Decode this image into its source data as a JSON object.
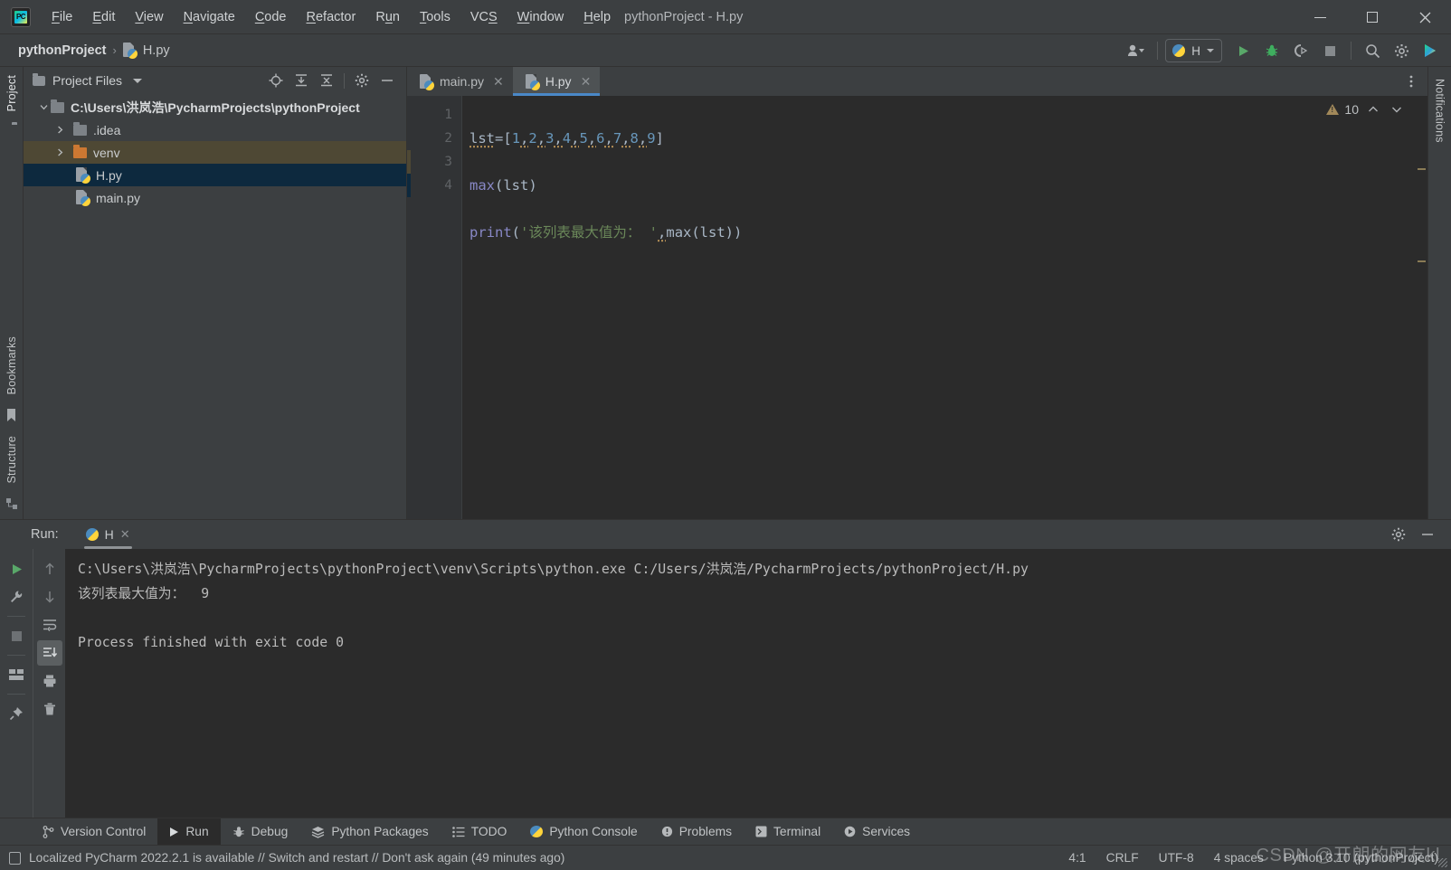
{
  "window": {
    "title": "pythonProject - H.py",
    "minimize": "–",
    "maximize": "☐",
    "close": "✕"
  },
  "menu": {
    "items": [
      {
        "label": "File",
        "mnemonic": "F"
      },
      {
        "label": "Edit",
        "mnemonic": "E"
      },
      {
        "label": "View",
        "mnemonic": "V"
      },
      {
        "label": "Navigate",
        "mnemonic": "N"
      },
      {
        "label": "Code",
        "mnemonic": "C"
      },
      {
        "label": "Refactor",
        "mnemonic": "R"
      },
      {
        "label": "Run",
        "mnemonic": "u"
      },
      {
        "label": "Tools",
        "mnemonic": "T"
      },
      {
        "label": "VCS",
        "mnemonic": "S"
      },
      {
        "label": "Window",
        "mnemonic": "W"
      },
      {
        "label": "Help",
        "mnemonic": "H"
      }
    ]
  },
  "navbar": {
    "breadcrumb": {
      "project": "pythonProject",
      "separator": "›",
      "file": "H.py"
    },
    "run_config": "H",
    "icons": {
      "account": "account-icon",
      "run": "run-icon",
      "debug": "debug-icon",
      "run_coverage": "run-with-coverage-icon",
      "stop": "stop-icon",
      "search": "search-everywhere-icon",
      "settings": "settings-icon",
      "updates": "updates-icon"
    }
  },
  "sidebar_left": {
    "tabs": [
      "Project"
    ],
    "bottom_tabs": [
      "Bookmarks",
      "Structure"
    ]
  },
  "sidebar_right": {
    "tabs": [
      "Notifications"
    ]
  },
  "project_panel": {
    "title": "Project Files",
    "actions": [
      "locate-icon",
      "expand-all-icon",
      "collapse-all-icon",
      "settings-icon",
      "hide-icon"
    ],
    "tree": [
      {
        "label": "C:\\Users\\洪岚浩\\PycharmProjects\\pythonProject",
        "type": "folder",
        "depth": 0,
        "expanded": true,
        "bold": true,
        "state": "none"
      },
      {
        "label": ".idea",
        "type": "folder",
        "depth": 1,
        "expanded": false,
        "bold": false,
        "state": "none"
      },
      {
        "label": "venv",
        "type": "folder-orange",
        "depth": 1,
        "expanded": false,
        "bold": false,
        "state": "olive"
      },
      {
        "label": "H.py",
        "type": "python",
        "depth": 2,
        "expanded": null,
        "bold": false,
        "state": "selected"
      },
      {
        "label": "main.py",
        "type": "python",
        "depth": 2,
        "expanded": null,
        "bold": false,
        "state": "none"
      }
    ]
  },
  "editor": {
    "tabs": [
      {
        "label": "main.py",
        "active": false,
        "icon": "python-file-icon"
      },
      {
        "label": "H.py",
        "active": true,
        "icon": "python-file-icon"
      }
    ],
    "line_numbers": [
      "1",
      "2",
      "3",
      "4"
    ],
    "code_lines": [
      "lst=[1,2,3,4,5,6,7,8,9]",
      "max(lst)",
      "print('该列表最大值为： ',max(lst))"
    ],
    "code_tokens": {
      "line1_var": "lst",
      "line1_eq": "=",
      "line1_open": "[",
      "line1_numbers": [
        "1",
        "2",
        "3",
        "4",
        "5",
        "6",
        "7",
        "8",
        "9"
      ],
      "line1_close": "]",
      "line2_fn": "max",
      "line2_args": "(lst)",
      "line3_fn": "print",
      "line3_open": "(",
      "line3_str": "'该列表最大值为： '",
      "line3_comma": ",",
      "line3_arg": "max(lst)",
      "line3_close": ")"
    },
    "inspection": {
      "icon": "warning-triangle-icon",
      "count": "10",
      "prev": "˄",
      "next": "˅"
    },
    "colors": {
      "background": "#2b2b2b",
      "gutter": "#313335",
      "number": "#6897bb",
      "function": "#8888c6",
      "string": "#6a8759",
      "default": "#a9b7c6",
      "tab_underline": "#4a88c7",
      "selection": "#0d293e"
    }
  },
  "run_panel": {
    "label": "Run:",
    "tab": "H",
    "toolbar_left": [
      "rerun-icon",
      "settings-wrench-icon",
      "stop-icon",
      "layout-icon",
      "pin-icon"
    ],
    "toolbar_right": [
      "up-arrow-icon",
      "down-arrow-icon",
      "soft-wrap-icon",
      "scroll-to-end-icon",
      "print-icon",
      "trash-icon"
    ],
    "header_actions": [
      "settings-icon",
      "hide-icon"
    ],
    "console_lines": [
      "C:\\Users\\洪岚浩\\PycharmProjects\\pythonProject\\venv\\Scripts\\python.exe C:/Users/洪岚浩/PycharmProjects/pythonProject/H.py",
      "该列表最大值为：  9",
      "",
      "Process finished with exit code 0"
    ]
  },
  "toolwindow_bar": {
    "items": [
      {
        "label": "Version Control",
        "icon": "branch-icon",
        "active": false
      },
      {
        "label": "Run",
        "icon": "run-icon",
        "active": true
      },
      {
        "label": "Debug",
        "icon": "debug-icon",
        "active": false
      },
      {
        "label": "Python Packages",
        "icon": "packages-icon",
        "active": false
      },
      {
        "label": "TODO",
        "icon": "todo-icon",
        "active": false
      },
      {
        "label": "Python Console",
        "icon": "python-icon",
        "active": false
      },
      {
        "label": "Problems",
        "icon": "problems-icon",
        "active": false
      },
      {
        "label": "Terminal",
        "icon": "terminal-icon",
        "active": false
      },
      {
        "label": "Services",
        "icon": "services-icon",
        "active": false
      }
    ]
  },
  "status_bar": {
    "message": "Localized PyCharm 2022.2.1 is available // Switch and restart // Don't ask again (49 minutes ago)",
    "message_icon": "notification-icon",
    "caret_position": "4:1",
    "line_separator": "CRLF",
    "encoding": "UTF-8",
    "indent": "4 spaces",
    "interpreter": "Python 3.10 (pythonProject)"
  },
  "watermark": "CSDN @开朗的网友kl"
}
